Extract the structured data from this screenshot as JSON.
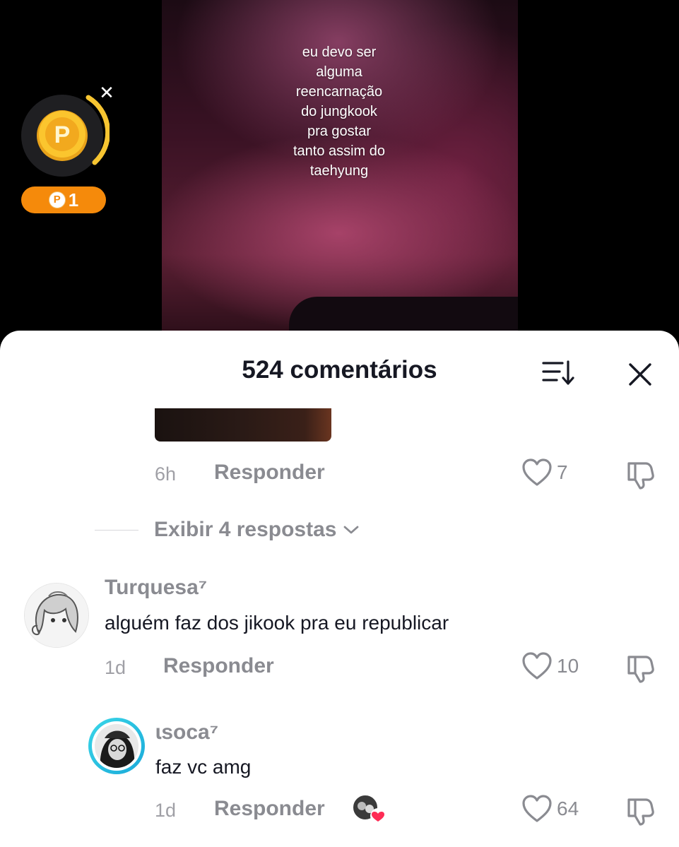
{
  "video": {
    "caption": "eu devo ser\nalguma\nreencarnação\ndo jungkook\npra gostar\ntanto assim do\ntaehyung"
  },
  "coin_widget": {
    "coin_letter": "P",
    "pill_icon": "P",
    "points": "1",
    "close_symbol": "✕",
    "accent_color": "#f58a0b"
  },
  "comments_sheet": {
    "title": "524 comentários",
    "sort_icon": "sort-descending-icon",
    "close_icon": "close-icon"
  },
  "comments": [
    {
      "time": "6h",
      "reply_label": "Responder",
      "likes": "7"
    },
    {
      "username": "Turquesa⁷",
      "text": "alguém faz dos jikook pra eu republicar",
      "time": "1d",
      "reply_label": "Responder",
      "likes": "10"
    },
    {
      "username": "ɩsoca⁷",
      "text": "faz vc amg",
      "time": "1d",
      "reply_label": "Responder",
      "likes": "64"
    }
  ],
  "view_replies": {
    "label": "Exibir 4 respostas"
  }
}
